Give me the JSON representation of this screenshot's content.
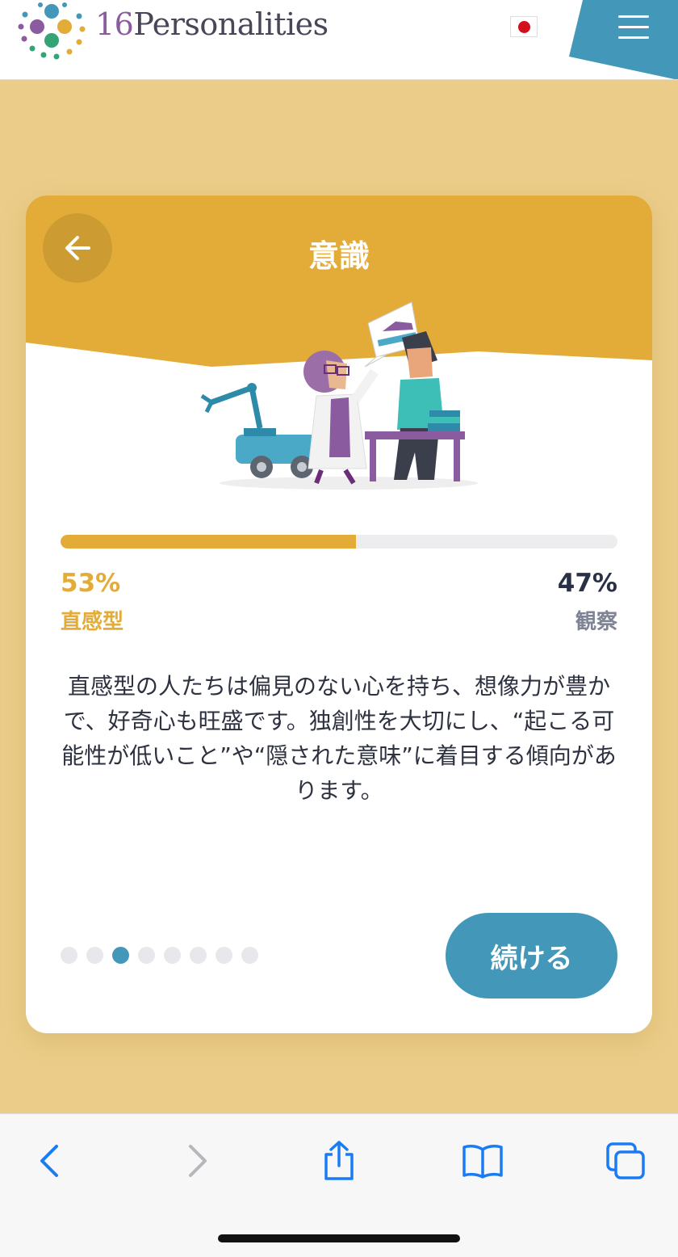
{
  "header": {
    "brand_number": "16",
    "brand_word": "Personalities",
    "language_flag": "Japan flag",
    "menu_icon": "hamburger-menu-icon"
  },
  "card": {
    "title": "意識",
    "back_icon": "arrow-left-icon",
    "illustration": "scientist-and-observer-illustration",
    "progress": {
      "fraction": 0.53,
      "left_percent": "53%",
      "left_label": "直感型",
      "right_percent": "47%",
      "right_label": "観察"
    },
    "description": "直感型の人たちは偏見のない心を持ち、想像力が豊かで、好奇心も旺盛です。独創性を大切にし、“起こる可能性が低いこと”や“隠された意味”に着目する傾向があります。",
    "pagination": {
      "total": 8,
      "active_index": 2
    },
    "continue_label": "続ける"
  },
  "colors": {
    "page_background": "#ebcd89",
    "accent_yellow": "#e3ac38",
    "accent_blue": "#4398b9",
    "text_dark": "#2a3146",
    "text_muted": "#7e8496"
  },
  "browser_bar": {
    "icons": [
      "back-icon",
      "forward-icon",
      "share-icon",
      "bookmarks-icon",
      "tabs-icon"
    ]
  }
}
